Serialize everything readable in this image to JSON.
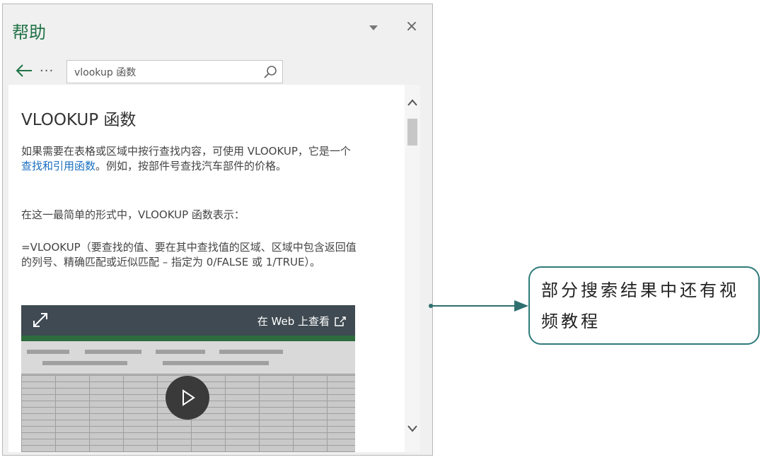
{
  "pane": {
    "title": "帮助",
    "close_glyph": "×",
    "more_glyph": "···",
    "search": {
      "value": "vlookup 函数"
    }
  },
  "article": {
    "title": "VLOOKUP 函数",
    "p1_before": "如果需要在表格或区域中按行查找内容，可使用 VLOOKUP，它是一个",
    "p1_link": "查找和引用函数",
    "p1_after": "。例如，按部件号查找汽车部件的价格。",
    "p2": "在这一最简单的形式中，VLOOKUP 函数表示：",
    "p3": "=VLOOKUP（要查找的值、要在其中查找值的区域、区域中包含返回值的列号、精确匹配或近似匹配 – 指定为 0/FALSE 或 1/TRUE）。"
  },
  "video": {
    "web_label": "在 Web 上查看"
  },
  "annotation": {
    "text": "部分搜索结果中还有视频教程",
    "border_color": "#2f7a7a"
  },
  "icons": {
    "back": "arrow-left-icon",
    "search": "magnifier-icon",
    "expand": "expand-arrows-icon",
    "open_external": "open-external-icon",
    "play": "play-icon"
  },
  "colors": {
    "title_green": "#217346",
    "link_blue": "#1a6fc0",
    "video_bar": "#3f4a52"
  }
}
